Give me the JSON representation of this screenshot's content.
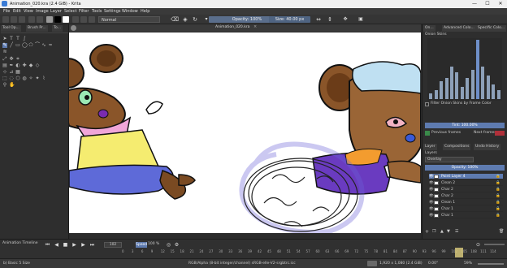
{
  "window": {
    "title": "Animation_020.kra (2.4 GiB) - Krita",
    "minimize": "—",
    "maximize": "☐",
    "close": "✕"
  },
  "menu": [
    "File",
    "Edit",
    "View",
    "Image",
    "Layer",
    "Select",
    "Filter",
    "Tools",
    "Settings",
    "Window",
    "Help"
  ],
  "toolbar": {
    "blend_mode": "Normal",
    "opacity": "Opacity: 100%",
    "size": "Size: 40.00 px"
  },
  "left_docker": {
    "tabs": [
      "Tool Op...",
      "Brush Pr...",
      "To..."
    ]
  },
  "canvas": {
    "doc_tab": "Animation_020.kra"
  },
  "right_docker": {
    "top_tabs": [
      "On...",
      "Advanced Colo...",
      "Specific Colo..."
    ],
    "onion_title": "Onion Skins",
    "onion_bars": [
      0.1,
      0.15,
      0.3,
      0.35,
      0.55,
      0.45,
      0.2,
      0.35,
      0.5,
      1.0,
      0.55,
      0.4,
      0.25,
      0.15
    ],
    "filter_label": "Filter Onion Skins by Frame Color",
    "tint": "Tint: 100.00%",
    "previous_frames": "Previous frames",
    "next_frames": "Next frames",
    "mid_tabs": [
      "Layer",
      "Compositions",
      "Undo History"
    ],
    "layers_title": "Layers",
    "blend": "Overlay",
    "opacity": "Opacity: 100%",
    "layers": [
      {
        "name": "Point Layer 4",
        "selected": true
      },
      {
        "name": "Clean 2",
        "selected": false
      },
      {
        "name": "Char 2",
        "selected": false
      },
      {
        "name": "Char 2",
        "selected": false
      },
      {
        "name": "Clean 1",
        "selected": false
      },
      {
        "name": "Char 1",
        "selected": false
      },
      {
        "name": "Char 1",
        "selected": false
      }
    ]
  },
  "timeline": {
    "title": "Animation Timeline",
    "frame": "102",
    "speed_label": "Speed",
    "speed": "100 %",
    "frame_numbers": [
      "0",
      "3",
      "6",
      "9",
      "12",
      "15",
      "18",
      "21",
      "24",
      "27",
      "30",
      "33",
      "36",
      "39",
      "42",
      "45",
      "48",
      "51",
      "54",
      "57",
      "60",
      "63",
      "66",
      "69",
      "72",
      "75",
      "78",
      "81",
      "84",
      "87",
      "90",
      "93",
      "96",
      "99",
      "102",
      "105",
      "108",
      "111",
      "114"
    ]
  },
  "status": {
    "brush": "b) Basic 5 Size",
    "color": "RGB/Alpha (8-bit integer/channel)  sRGB-elle-V2-srgbtrc.icc",
    "dims": "1,920 x 1,080 (2.4 GiB)",
    "rotation": "0.00°",
    "zoom": "59%"
  },
  "colors": {
    "fg": "#000000",
    "bg": "#ffffff",
    "accent": "#5a6e8c",
    "selected_layer": "#5e7bb0"
  }
}
